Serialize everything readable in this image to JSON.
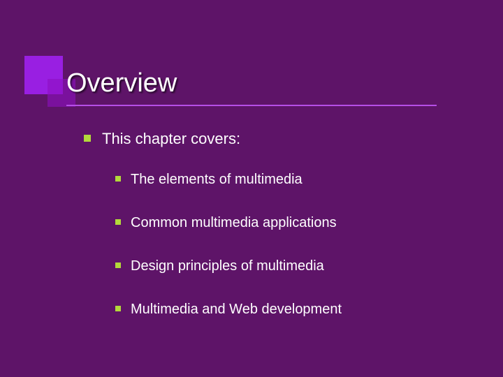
{
  "slide": {
    "title": "Overview",
    "intro": "This chapter covers:",
    "subitems": [
      "The elements of multimedia",
      "Common multimedia applications",
      "Design principles of multimedia",
      "Multimedia and Web development"
    ]
  }
}
